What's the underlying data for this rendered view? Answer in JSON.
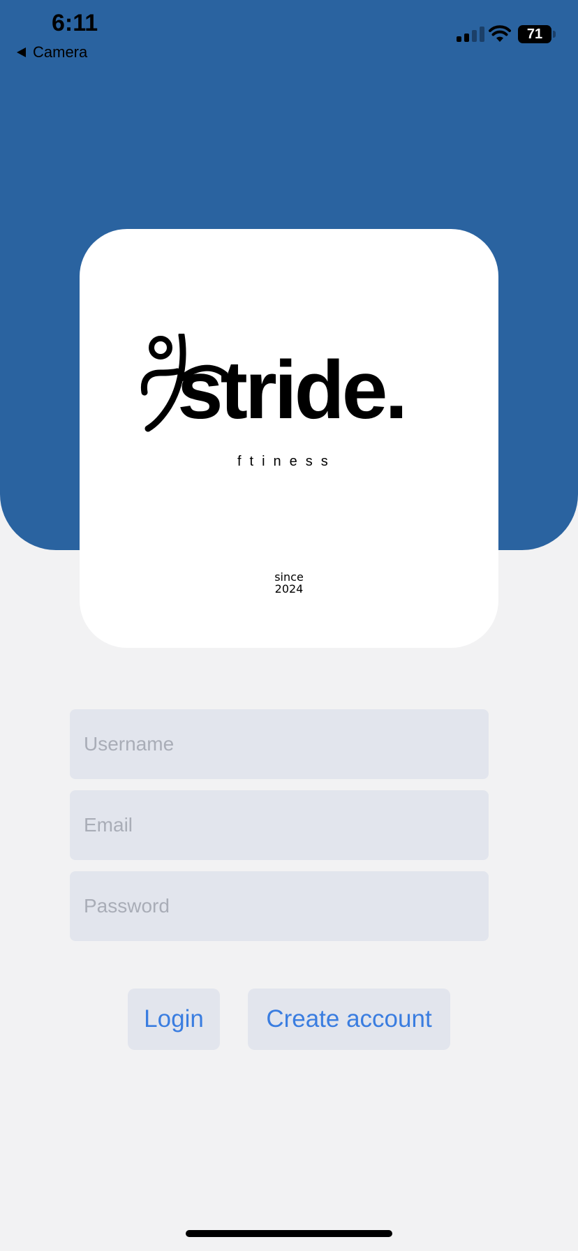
{
  "status_bar": {
    "time": "6:11",
    "back_label": "Camera",
    "battery_level": "71"
  },
  "logo": {
    "word": "stride.",
    "subtitle": "ftiness",
    "since_line1": "since",
    "since_line2": "2024"
  },
  "form": {
    "username_placeholder": "Username",
    "email_placeholder": "Email",
    "password_placeholder": "Password"
  },
  "buttons": {
    "login": "Login",
    "create_account": "Create account"
  },
  "colors": {
    "header": "#2a63a0",
    "background": "#f2f2f3",
    "field": "#e2e5ed",
    "button_text": "#3a7de0"
  }
}
